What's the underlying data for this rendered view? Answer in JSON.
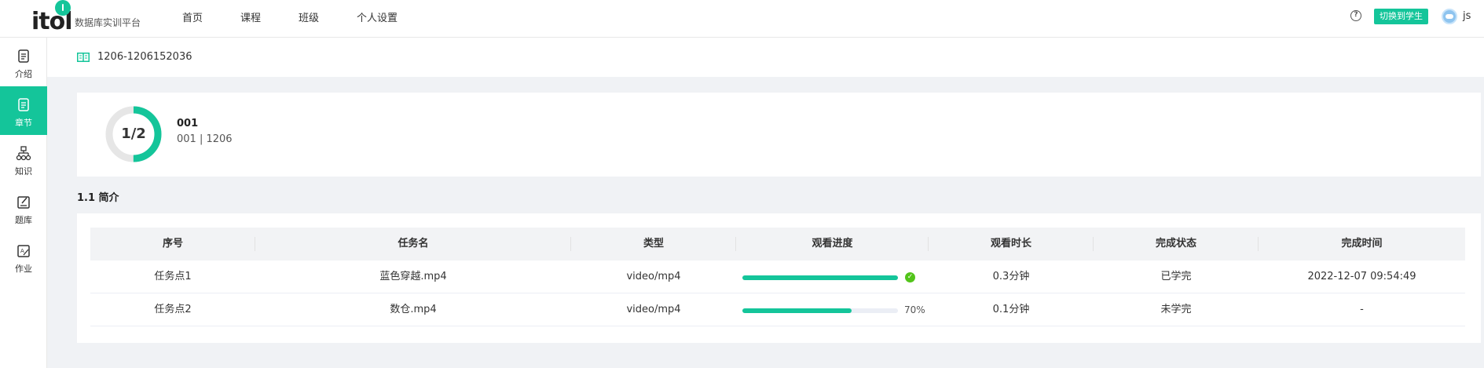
{
  "brand": {
    "logo_text": "itol",
    "platform_name": "数据库实训平台",
    "accent": "#14c59a"
  },
  "nav": {
    "items": [
      "首页",
      "课程",
      "班级",
      "个人设置"
    ]
  },
  "header": {
    "help_icon": "?",
    "switch_label": "切换到学生",
    "username": "js"
  },
  "sidebar": {
    "items": [
      {
        "label": "介绍",
        "icon": "document-icon"
      },
      {
        "label": "章节",
        "icon": "chapter-icon"
      },
      {
        "label": "知识",
        "icon": "hierarchy-icon"
      },
      {
        "label": "题库",
        "icon": "question-bank-icon"
      },
      {
        "label": "作业",
        "icon": "homework-icon"
      }
    ],
    "active_index": 1
  },
  "breadcrumb": "1206-1206152036",
  "summary": {
    "progress_text": "1/2",
    "progress_fraction": 0.5,
    "title": "001",
    "subtitle": "001 | 1206"
  },
  "section_title": "1.1 简介",
  "table": {
    "columns": [
      "序号",
      "任务名",
      "类型",
      "观看进度",
      "观看时长",
      "完成状态",
      "完成时间"
    ],
    "rows": [
      {
        "seq": "任务点1",
        "name": "蓝色穿越.mp4",
        "type": "video/mp4",
        "progress": 1.0,
        "progress_label": "",
        "duration": "0.3分钟",
        "status": "已学完",
        "finished_at": "2022-12-07 09:54:49"
      },
      {
        "seq": "任务点2",
        "name": "数仓.mp4",
        "type": "video/mp4",
        "progress": 0.7,
        "progress_label": "70%",
        "duration": "0.1分钟",
        "status": "未学完",
        "finished_at": "-"
      }
    ]
  }
}
